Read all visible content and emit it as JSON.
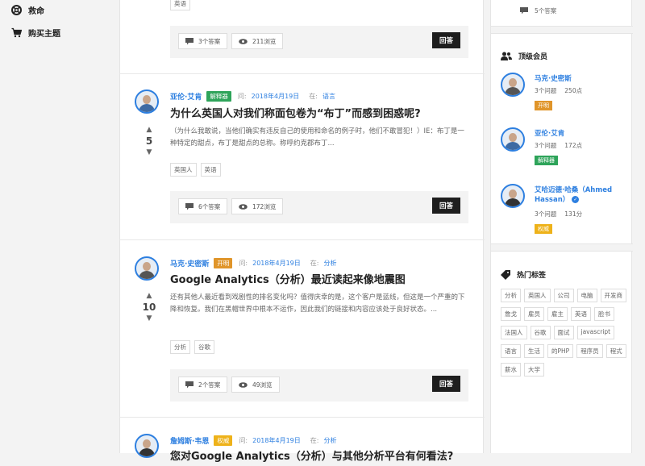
{
  "nav": {
    "items": [
      {
        "label": "救命",
        "icon": "lifebuoy-icon"
      },
      {
        "label": "购买主题",
        "icon": "cart-icon"
      }
    ]
  },
  "top_partial": {
    "tag": "英语",
    "answers": "3个答案",
    "views": "211浏览",
    "answer_label": "回答"
  },
  "questions": [
    {
      "author": "亚伦·艾肯",
      "badge": "解释器",
      "asked": "问:",
      "date": "2018年4月19日",
      "in": "在:",
      "category": "语言",
      "title": "为什么英国人对我们称面包卷为“布丁”而感到困惑呢?",
      "votes": "5",
      "excerpt": "（为什么我敢说，当他们确实有违反自己的使用和命名的例子时，他们不敢冒犯！）IE：布丁是一种特定的甜点，布丁是甜点的总称。称呼约克郡布丁...",
      "tags": [
        "英国人",
        "英语"
      ],
      "answers": "6个答案",
      "views": "172浏览",
      "answer_label": "回答"
    },
    {
      "author": "马克·史密斯",
      "badge": "开明",
      "asked": "问:",
      "date": "2018年4月19日",
      "in": "在:",
      "category": "分析",
      "title": "Google Analytics（分析）最近读起来像地震图",
      "votes": "10",
      "excerpt": "还有其他人最近看到戏剧性的排名变化吗？值得庆幸的是，这个客户是蓝线，但这是一个严重的下降和恢复。我们在黑帽世界中根本不运作，因此我们的链接和内容应该处于良好状态。...",
      "tags": [
        "分析",
        "谷歌"
      ],
      "answers": "2个答案",
      "views": "49浏览",
      "answer_label": "回答"
    },
    {
      "author": "詹姆斯·韦恩",
      "badge": "权威",
      "asked": "问:",
      "date": "2018年4月19日",
      "in": "在:",
      "category": "分析",
      "title": "您对Google Analytics（分析）与其他分析平台有何看法?"
    }
  ],
  "sidebar": {
    "top_answers": "5个答案",
    "members_title": "顶级会员",
    "members": [
      {
        "name": "马克·史密斯",
        "questions": "3个问题",
        "points": "250点",
        "badge": "开明"
      },
      {
        "name": "亚伦·艾肯",
        "questions": "3个问题",
        "points": "172点",
        "badge": "解释器"
      },
      {
        "name": "艾哈迈德·哈桑（Ahmed Hassan）",
        "questions": "3个问题",
        "points": "131分",
        "badge": "权威"
      }
    ],
    "tags_title": "热门标签",
    "tags": [
      "分析",
      "英国人",
      "公司",
      "电脑",
      "开发商",
      "詹戈",
      "雇员",
      "雇主",
      "英语",
      "脸书",
      "法国人",
      "谷歌",
      "面试",
      "javascript",
      "语言",
      "生活",
      "的PHP",
      "程序员",
      "程式",
      "薪水",
      "大学"
    ]
  },
  "colors": {
    "accent": "#2d7fe0",
    "dark_button": "#1e1e1e",
    "green": "#2ea45a",
    "orange": "#e0952a",
    "yellow": "#eeb21a"
  }
}
